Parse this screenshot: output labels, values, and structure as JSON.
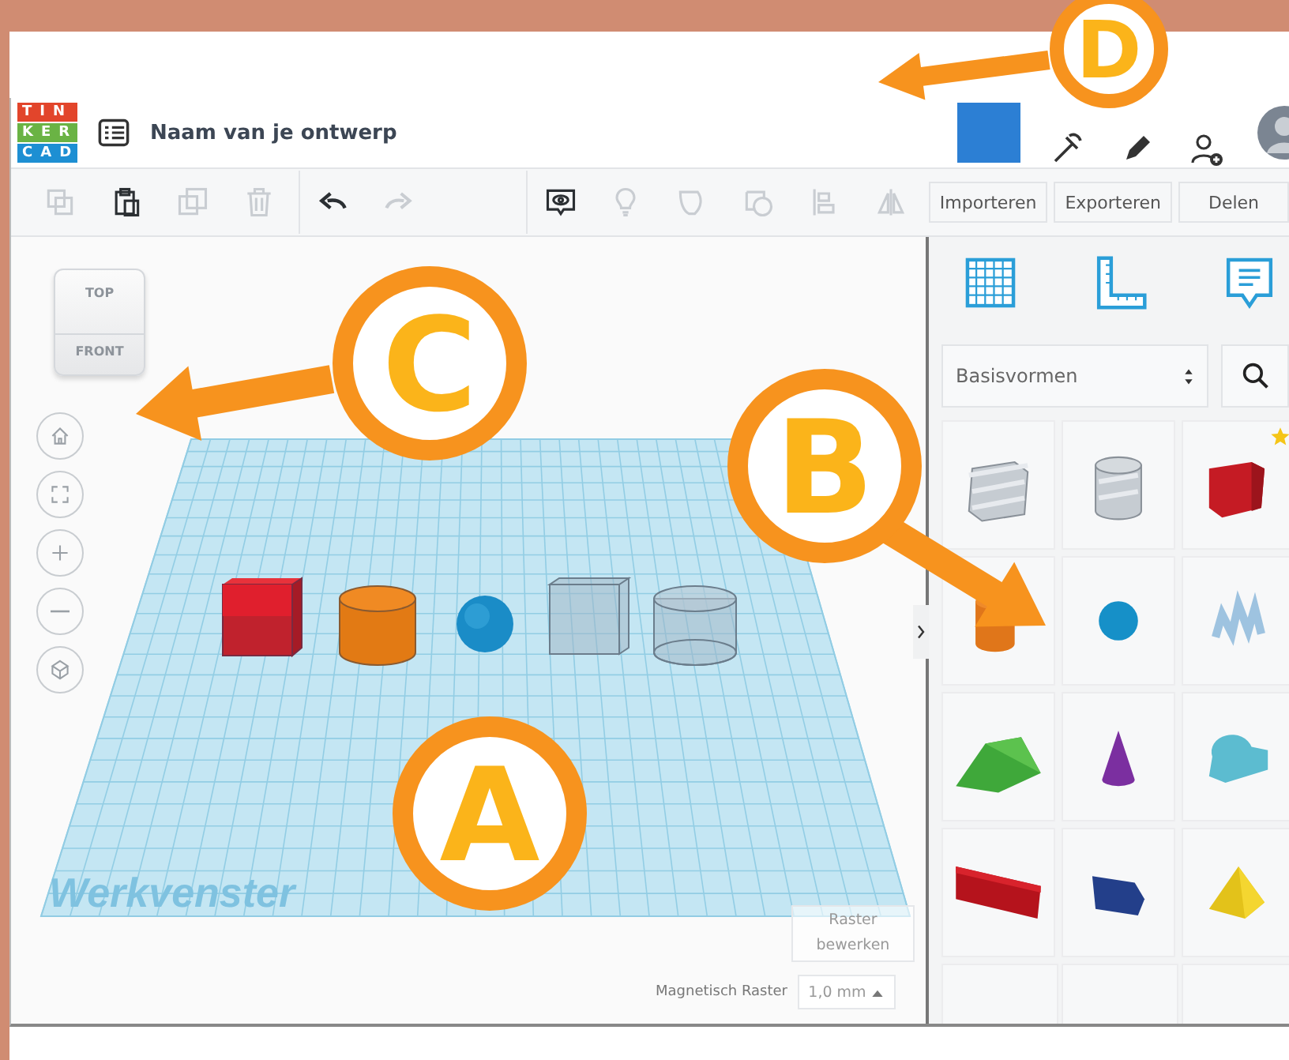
{
  "app_header": {
    "logo_rows": [
      "TIN",
      "KER",
      "CAD"
    ],
    "title": "Naam van je ontwerp"
  },
  "toolbar": {
    "tools": [
      {
        "kind": "copy",
        "disabled": true
      },
      {
        "kind": "paste",
        "disabled": false
      },
      {
        "kind": "duplicate",
        "disabled": true
      },
      {
        "kind": "delete",
        "disabled": true
      },
      {
        "kind": "undo",
        "disabled": false
      },
      {
        "kind": "redo",
        "disabled": true
      },
      {
        "kind": "notes",
        "disabled": false
      },
      {
        "kind": "bulb",
        "disabled": true
      },
      {
        "kind": "solid",
        "disabled": true
      },
      {
        "kind": "hole",
        "disabled": true
      },
      {
        "kind": "align",
        "disabled": true
      },
      {
        "kind": "mirror",
        "disabled": true
      }
    ],
    "buttons": [
      "Importeren",
      "Exporteren",
      "Delen"
    ]
  },
  "view_cube": {
    "top": "TOP",
    "front": "FRONT"
  },
  "nav_buttons": [
    {
      "kind": "home"
    },
    {
      "kind": "fit"
    },
    {
      "kind": "zoom-in"
    },
    {
      "kind": "zoom-out"
    },
    {
      "kind": "perspective"
    }
  ],
  "workplane": {
    "label": "Werkvenster",
    "objects": [
      {
        "kind": "box"
      },
      {
        "kind": "cylinder"
      },
      {
        "kind": "sphere"
      },
      {
        "kind": "box-hole"
      },
      {
        "kind": "cylinder-hole"
      }
    ]
  },
  "grid_controls": {
    "edit_button": "Raster bewerken",
    "snap_label": "Magnetisch Raster",
    "snap_value": "1,0 mm"
  },
  "shapes_panel": {
    "category": "Basisvormen",
    "shapes": [
      {
        "kind": "box-hole",
        "starred": false
      },
      {
        "kind": "cylinder-hole",
        "starred": false
      },
      {
        "kind": "box",
        "starred": true
      },
      {
        "kind": "cylinder",
        "starred": false
      },
      {
        "kind": "sphere",
        "starred": false
      },
      {
        "kind": "scribble",
        "starred": false
      },
      {
        "kind": "roof",
        "starred": false
      },
      {
        "kind": "cone",
        "starred": false
      },
      {
        "kind": "round-roof",
        "starred": false
      },
      {
        "kind": "text",
        "starred": false
      },
      {
        "kind": "polygon",
        "starred": false
      },
      {
        "kind": "pyramid",
        "starred": false
      }
    ]
  },
  "callouts": [
    {
      "letter": "A",
      "arrow": false
    },
    {
      "letter": "B",
      "arrow": true
    },
    {
      "letter": "C",
      "arrow": true
    },
    {
      "letter": "D",
      "arrow": true
    }
  ]
}
